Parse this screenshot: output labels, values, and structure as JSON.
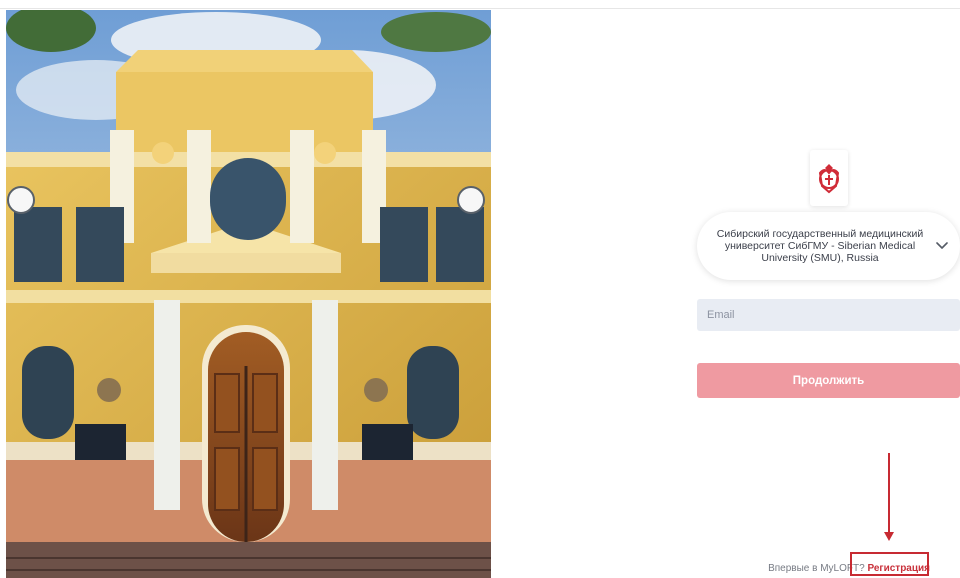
{
  "organization": {
    "name": "Сибирский государственный медицинский университет СибГМУ - Siberian Medical University (SMU), Russia"
  },
  "email": {
    "placeholder": "Email",
    "value": ""
  },
  "continue": {
    "label": "Продолжить"
  },
  "signup": {
    "prompt": "Впервые в MyLOFT?",
    "link": "Регистрация"
  },
  "colors": {
    "brand_red": "#c9313b",
    "continue_button": "#ef9aa1",
    "input_background": "#e8ecf3",
    "annotation_red": "#c72a32"
  },
  "icons": {
    "logo": "university-crest-icon",
    "dropdown": "chevron-down-icon"
  }
}
